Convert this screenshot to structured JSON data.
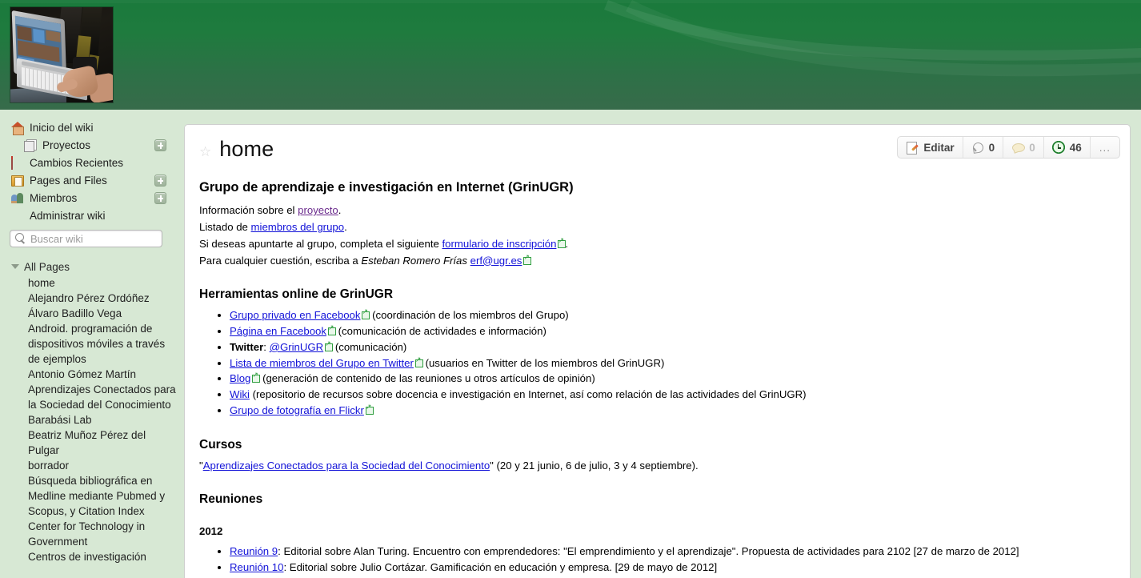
{
  "banner": {
    "photo_alt": "laptop-photo"
  },
  "sidebar": {
    "nav": [
      {
        "label": "Inicio del wiki",
        "icon": "house-icon",
        "sub": false,
        "plus": false
      },
      {
        "label": "Proyectos",
        "icon": "pages-stack-icon",
        "sub": true,
        "plus": true
      },
      {
        "label": "Cambios Recientes",
        "icon": "calendar-icon",
        "sub": false,
        "plus": false
      },
      {
        "label": "Pages and Files",
        "icon": "folder-icon",
        "sub": false,
        "plus": true
      },
      {
        "label": "Miembros",
        "icon": "people-icon",
        "sub": false,
        "plus": true
      },
      {
        "label": "Administrar wiki",
        "icon": "gear-icon",
        "sub": false,
        "plus": false
      }
    ],
    "search": {
      "placeholder": "Buscar wiki",
      "value": "",
      "icon": "search-icon"
    },
    "all_pages_label": "All Pages",
    "pages": [
      "home",
      "Alejandro Pérez Ordóñez",
      "Álvaro Badillo Vega",
      "Android. programación de dispositivos móviles a través de ejemplos",
      "Antonio Gómez Martín",
      "Aprendizajes Conectados para la Sociedad del Conocimiento",
      "Barabási Lab",
      "Beatriz Muñoz Pérez del Pulgar",
      "borrador",
      "Búsqueda bibliográfica en Medline mediante Pubmed y Scopus, y Citation Index",
      "Center for Technology in Government",
      "Centros de investigación"
    ]
  },
  "page": {
    "title": "home",
    "star_icon": "star-icon",
    "toolbar": {
      "edit_label": "Editar",
      "edit_icon": "edit-page-icon",
      "tags_count": "0",
      "tags_icon": "tag-icon",
      "comments_count": "0",
      "comments_icon": "comment-icon",
      "history_count": "46",
      "history_icon": "history-clock-icon",
      "more_label": "..."
    }
  },
  "article": {
    "heading": "Grupo de aprendizaje e investigación en Internet (GrinUGR)",
    "intro": [
      {
        "pre": "Información sobre el ",
        "link": "proyecto",
        "visited": true,
        "ext": false,
        "post": "."
      },
      {
        "pre": "Listado de ",
        "link": "miembros del grupo",
        "visited": false,
        "ext": false,
        "post": "."
      },
      {
        "pre": "Si deseas apuntarte al grupo, completa el siguiente ",
        "link": "formulario de inscripción",
        "visited": false,
        "ext": true,
        "post": "."
      },
      {
        "pre": "Para cualquier cuestión, escriba a ",
        "em": "Esteban Romero Frías",
        "link": "erf@ugr.es",
        "visited": false,
        "ext": true,
        "post": ""
      }
    ],
    "tools_heading": "Herramientas online de GrinUGR",
    "tools": [
      {
        "bold_prefix": "",
        "link": "Grupo privado en Facebook",
        "ext": true,
        "post": " (coordinación de los miembros del Grupo)"
      },
      {
        "bold_prefix": "",
        "link": "Página en Facebook",
        "ext": true,
        "post": " (comunicación de actividades e información)"
      },
      {
        "bold_prefix": "Twitter",
        "link": "@GrinUGR",
        "ext": true,
        "post": " (comunicación)"
      },
      {
        "bold_prefix": "",
        "link": "Lista de miembros del Grupo en Twitter",
        "ext": true,
        "post": " (usuarios en Twitter de los miembros del GrinUGR)"
      },
      {
        "bold_prefix": "",
        "link": "Blog",
        "ext": true,
        "post": " (generación de contenido de las reuniones u otros artículos de opinión)"
      },
      {
        "bold_prefix": "",
        "link": "Wiki",
        "ext": false,
        "post": " (repositorio de recursos sobre docencia e investigación en Internet, así como relación de las actividades del GrinUGR)"
      },
      {
        "bold_prefix": "",
        "link": "Grupo de fotografía en Flickr",
        "ext": true,
        "post": ""
      }
    ],
    "cursos_heading": "Cursos",
    "cursos_line": {
      "pre": "\"",
      "link": "Aprendizajes Conectados para la Sociedad del Conocimiento",
      "post": "\" (20 y 21 junio, 6 de julio, 3 y 4 septiembre)."
    },
    "reuniones_heading": "Reuniones",
    "year_heading": "2012",
    "reuniones": [
      {
        "link": "Reunión 9",
        "post": ": Editorial sobre Alan Turing. Encuentro con emprendedores: \"El emprendimiento y el aprendizaje\". Propuesta de actividades para 2102 [27 de marzo de 2012]"
      },
      {
        "link": "Reunión 10",
        "post": ": Editorial sobre Julio Cortázar. Gamificación en educación y empresa. [29 de mayo de 2012]"
      }
    ]
  },
  "colors": {
    "banner_green_top": "#1a7a3c",
    "banner_green_bottom": "#376b4a",
    "sidebar_bg": "#d7e8d4",
    "link_blue": "#1313d8",
    "link_visited": "#6a2a8c",
    "external_icon_green": "#2f9e3f"
  }
}
